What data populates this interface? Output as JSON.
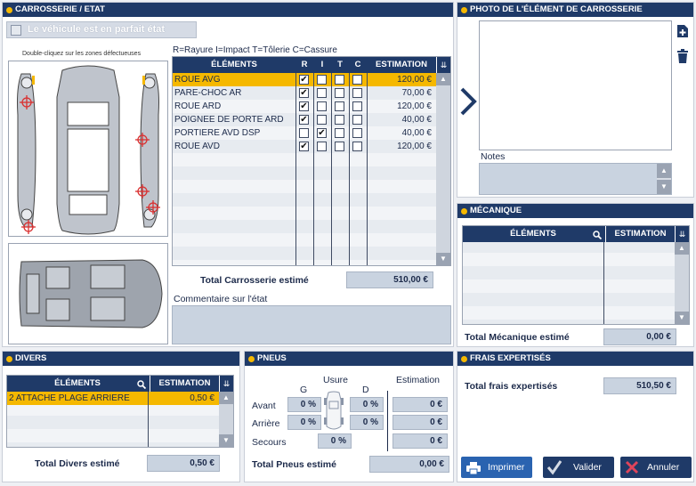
{
  "carrosserie": {
    "title": "CARROSSERIE / ETAT",
    "perfect_label": "Le véhicule est en parfait état",
    "hint": "Double-cliquez sur les zones défectueuses",
    "legend": "R=Rayure   I=Impact   T=Tôlerie   C=Cassure",
    "columns": {
      "elements": "ÉLÉMENTS",
      "r": "R",
      "i": "I",
      "t": "T",
      "c": "C",
      "estimation": "ESTIMATION"
    },
    "rows": [
      {
        "name": "ROUE AVG",
        "r": "✔",
        "i": "",
        "t": "",
        "c": "",
        "estimation": "120,00 €",
        "selected": true
      },
      {
        "name": "PARE-CHOC AR",
        "r": "✔",
        "i": "",
        "t": "",
        "c": "",
        "estimation": "70,00 €"
      },
      {
        "name": "ROUE ARD",
        "r": "✔",
        "i": "",
        "t": "",
        "c": "",
        "estimation": "120,00 €"
      },
      {
        "name": "POIGNEE DE PORTE ARD",
        "r": "✔",
        "i": "",
        "t": "",
        "c": "",
        "estimation": "40,00 €"
      },
      {
        "name": "PORTIERE AVD DSP",
        "r": "",
        "i": "✔",
        "t": "",
        "c": "",
        "estimation": "40,00 €"
      },
      {
        "name": "ROUE AVD",
        "r": "✔",
        "i": "",
        "t": "",
        "c": "",
        "estimation": "120,00 €"
      }
    ],
    "total_label": "Total Carrosserie estimé",
    "total_value": "510,00 €",
    "comment_label": "Commentaire sur l'état"
  },
  "photo": {
    "title": "PHOTO DE L'ÉLÉMENT DE CARROSSERIE",
    "notes_label": "Notes"
  },
  "mecanique": {
    "title": "MÉCANIQUE",
    "col_elements": "ÉLÉMENTS",
    "col_estimation": "ESTIMATION",
    "total_label": "Total Mécanique estimé",
    "total_value": "0,00 €"
  },
  "divers": {
    "title": "DIVERS",
    "col_elements": "ÉLÉMENTS",
    "col_estimation": "ESTIMATION",
    "rows": [
      {
        "name": "2 ATTACHE PLAGE ARRIERE",
        "estimation": "0,50 €"
      }
    ],
    "total_label": "Total Divers estimé",
    "total_value": "0,50 €"
  },
  "pneus": {
    "title": "PNEUS",
    "usure": "Usure",
    "estimation": "Estimation",
    "g": "G",
    "d": "D",
    "avant": "Avant",
    "arriere": "Arrière",
    "secours": "Secours",
    "avant_g": "0 %",
    "avant_d": "0 %",
    "arriere_g": "0 %",
    "arriere_d": "0 %",
    "secours_val": "0 %",
    "avant_est": "0 €",
    "arriere_est": "0 €",
    "secours_est": "0 €",
    "total_label": "Total Pneus estimé",
    "total_value": "0,00 €"
  },
  "frais": {
    "title": "FRAIS EXPERTISÉS",
    "total_label": "Total frais expertisés",
    "total_value": "510,50 €"
  },
  "buttons": {
    "print": "Imprimer",
    "validate": "Valider",
    "cancel": "Annuler"
  },
  "colors": {
    "header": "#1f3a68",
    "selected": "#f5b800",
    "accent": "#f5b800"
  }
}
